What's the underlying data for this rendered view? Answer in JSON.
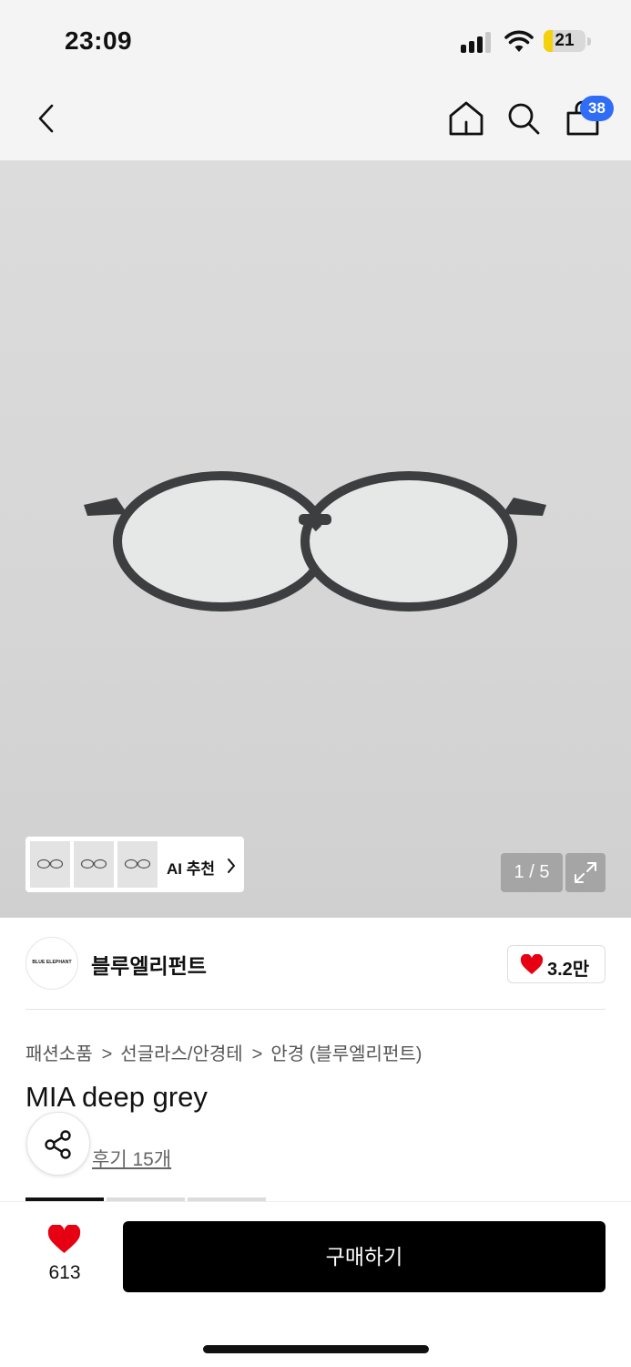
{
  "status_bar": {
    "time": "23:09",
    "battery_level": "21",
    "battery_fraction": 0.21,
    "signal_icon": "signal-bars-icon",
    "wifi_icon": "wifi-icon",
    "battery_color": "#f5d10b"
  },
  "nav": {
    "back_icon": "chevron-left-icon",
    "home_icon": "home-icon",
    "search_icon": "search-icon",
    "cart_icon": "shopping-bag-icon",
    "cart_count": "38",
    "badge_color": "#2f6df6"
  },
  "gallery": {
    "ai_recommend_label": "AI 추천",
    "page_indicator": "1 / 5",
    "expand_icon": "expand-icon"
  },
  "brand": {
    "logo_text": "BLUE ELEPHANT",
    "name": "블루엘리펀트",
    "likes": "3.2만"
  },
  "product": {
    "breadcrumb": [
      "패션소품",
      "선글라스/안경테",
      "안경 (블루엘리펀트)"
    ],
    "title": "MIA deep grey",
    "review_link": "후기 15개"
  },
  "bottom": {
    "wish_count": "613",
    "buy_label": "구매하기",
    "accent_color": "#e60012"
  }
}
